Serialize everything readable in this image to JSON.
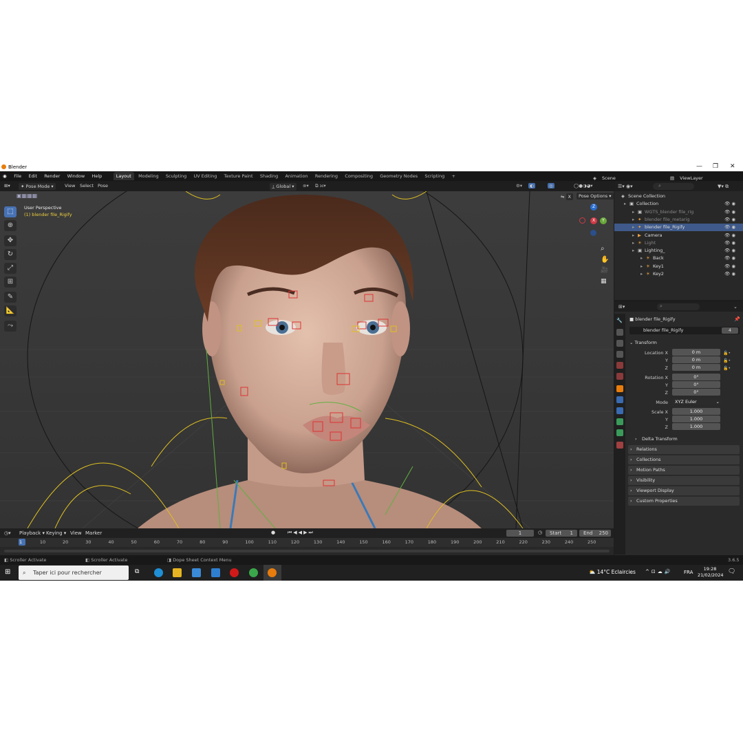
{
  "window": {
    "title": "Blender",
    "controls": [
      "—",
      "❐",
      "✕"
    ]
  },
  "menubar": {
    "menus": [
      "File",
      "Edit",
      "Render",
      "Window",
      "Help"
    ],
    "workspaces": [
      "Layout",
      "Modeling",
      "Sculpting",
      "UV Editing",
      "Texture Paint",
      "Shading",
      "Animation",
      "Rendering",
      "Compositing",
      "Geometry Nodes",
      "Scripting"
    ],
    "add_tab": "+",
    "scene": "Scene",
    "view_layer": "ViewLayer"
  },
  "viewport_header": {
    "mode": "Pose Mode",
    "menus": [
      "View",
      "Select",
      "Pose"
    ],
    "transform_orientation": "Global",
    "pose_options": "Pose Options",
    "x_mirror": "X"
  },
  "viewport": {
    "view_name": "User Perspective",
    "active_object": "(1) blender file_Rigify",
    "gizmo_axes": [
      "Z",
      "Y",
      "X"
    ]
  },
  "toolbar": {
    "tools": [
      "select-box",
      "cursor",
      "move",
      "rotate",
      "scale",
      "transform",
      "annotate",
      "measure",
      "relax"
    ]
  },
  "outliner": {
    "search_placeholder": "",
    "items": [
      {
        "label": "Scene Collection",
        "indent": 0,
        "type": "scene"
      },
      {
        "label": "Collection",
        "indent": 1,
        "type": "collection"
      },
      {
        "label": "WGTS_blender file_rig",
        "indent": 2,
        "type": "collection",
        "dim": true
      },
      {
        "label": "blender file_metarig",
        "indent": 2,
        "type": "armature",
        "dim": true
      },
      {
        "label": "blender file_Rigify",
        "indent": 2,
        "type": "armature",
        "selected": true
      },
      {
        "label": "Camera",
        "indent": 2,
        "type": "camera"
      },
      {
        "label": "Light",
        "indent": 2,
        "type": "light",
        "dim": true
      },
      {
        "label": "Lighting_",
        "indent": 2,
        "type": "collection"
      },
      {
        "label": "Back",
        "indent": 3,
        "type": "light"
      },
      {
        "label": "Key1",
        "indent": 3,
        "type": "light"
      },
      {
        "label": "Key2",
        "indent": 3,
        "type": "light"
      }
    ]
  },
  "properties": {
    "object_name": "blender file_Rigify",
    "data_name": "blender file_Rigify",
    "users": "4",
    "transform_title": "Transform",
    "location": {
      "label": "Location X",
      "x": "0 m",
      "y": "0 m",
      "z": "0 m"
    },
    "rotation": {
      "label": "Rotation X",
      "x": "0°",
      "y": "0°",
      "z": "0°"
    },
    "mode_label": "Mode",
    "mode": "XYZ Euler",
    "scale": {
      "label": "Scale X",
      "x": "1.000",
      "y": "1.000",
      "z": "1.000"
    },
    "axis_labels": {
      "y": "Y",
      "z": "Z"
    },
    "panels": [
      "Delta Transform",
      "Relations",
      "Collections",
      "Motion Paths",
      "Visibility",
      "Viewport Display",
      "Custom Properties"
    ]
  },
  "timeline": {
    "menus": [
      "Playback",
      "Keying",
      "View",
      "Marker"
    ],
    "current_frame": "1",
    "start_label": "Start",
    "start": "1",
    "end_label": "End",
    "end": "250",
    "ruler": [
      "1",
      "10",
      "20",
      "30",
      "40",
      "50",
      "60",
      "70",
      "80",
      "90",
      "100",
      "110",
      "120",
      "130",
      "140",
      "150",
      "160",
      "170",
      "180",
      "190",
      "200",
      "210",
      "220",
      "230",
      "240",
      "250"
    ]
  },
  "statusbar": {
    "left1": "Scroller Activate",
    "left2": "Scroller Activate",
    "left3": "Dope Sheet Context Menu",
    "version": "3.6.5"
  },
  "taskbar": {
    "search_placeholder": "Taper ici pour rechercher",
    "weather": "14°C  Eclaircies",
    "lang": "FRA",
    "time": "19:28",
    "date": "21/02/2024"
  },
  "colors": {
    "accent": "#4772b3",
    "selection": "#3f5a8a",
    "orange": "#e87d0d",
    "bone_yellow": "#e0c020",
    "bone_red": "#d02020"
  }
}
